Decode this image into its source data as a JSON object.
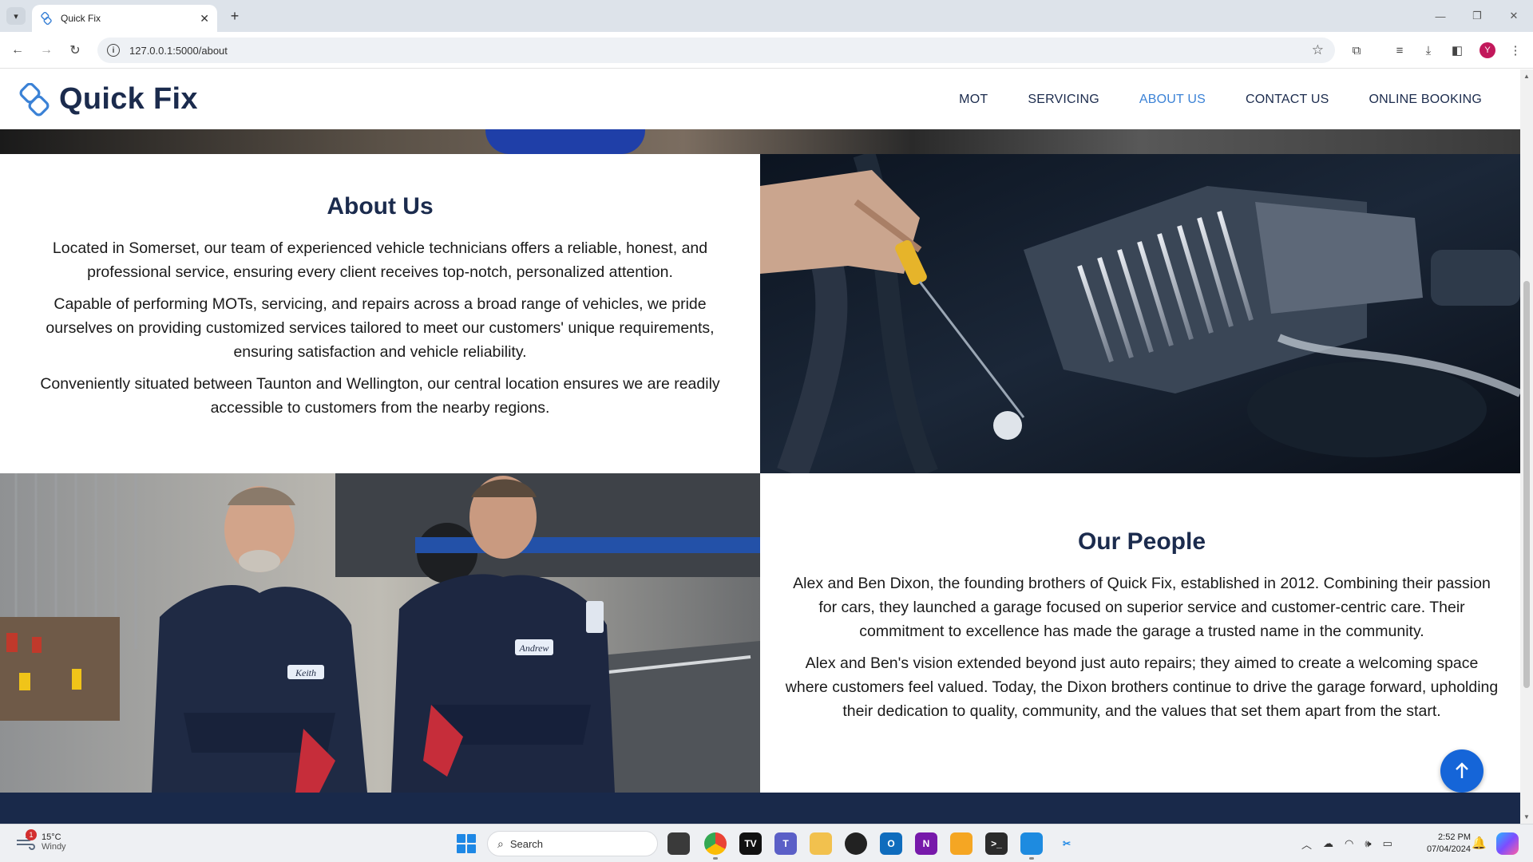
{
  "browser": {
    "tab_title": "Quick Fix",
    "url": "127.0.0.1:5000/about",
    "profile_initial": "Y"
  },
  "site": {
    "brand": "Quick Fix",
    "nav": [
      {
        "label": "MOT",
        "active": false
      },
      {
        "label": "SERVICING",
        "active": false
      },
      {
        "label": "ABOUT US",
        "active": true
      },
      {
        "label": "CONTACT US",
        "active": false
      },
      {
        "label": "ONLINE BOOKING",
        "active": false
      }
    ],
    "accent_color": "#3b82d6",
    "heading_color": "#1b2b4d",
    "footer_color": "#19294a"
  },
  "about": {
    "heading": "About Us",
    "paragraphs": [
      "Located in Somerset, our team of experienced vehicle technicians offers a reliable, honest, and professional service, ensuring every client receives top-notch, personalized attention.",
      "Capable of performing MOTs, servicing, and repairs across a broad range of vehicles, we pride ourselves on providing customized services tailored to meet our customers' unique requirements, ensuring satisfaction and vehicle reliability.",
      "Conveniently situated between Taunton and Wellington, our central location ensures we are readily accessible to customers from the nearby regions."
    ]
  },
  "people": {
    "heading": "Our People",
    "paragraphs": [
      "Alex and Ben Dixon, the founding brothers of Quick Fix, established in 2012. Combining their passion for cars, they launched a garage focused on superior service and customer-centric care. Their commitment to excellence has made the garage a trusted name in the community.",
      "Alex and Ben's vision extended beyond just auto repairs; they aimed to create a welcoming space where customers feel valued. Today, the Dixon brothers continue to drive the garage forward, upholding their dedication to quality, community, and the values that set them apart from the start."
    ]
  },
  "photos": {
    "mechanic_left_badge": "Keith",
    "mechanic_right_badge": "Andrew"
  },
  "taskbar": {
    "weather_temp": "15°C",
    "weather_cond": "Windy",
    "weather_badge": "1",
    "search_label": "Search",
    "time": "2:52 PM",
    "date": "07/04/2024"
  }
}
